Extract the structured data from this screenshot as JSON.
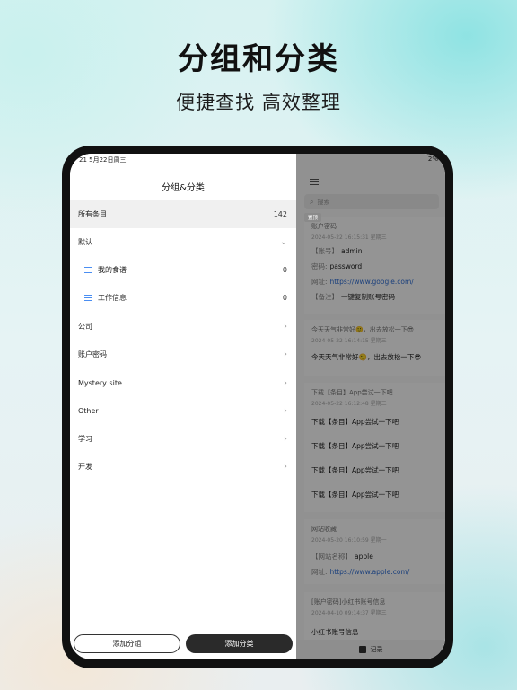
{
  "headline": "分组和分类",
  "subline": "便捷查找 高效整理",
  "status_bar": {
    "time_date": "21   5月22日周三",
    "battery": "2%"
  },
  "sidebar": {
    "title": "分组&分类",
    "all_items": {
      "label": "所有条目",
      "count": "142"
    },
    "groups": [
      {
        "label": "默认",
        "chevron": "⌄"
      },
      {
        "label": "我的食谱",
        "count": "0",
        "icon": "list-icon"
      },
      {
        "label": "工作信息",
        "count": "0",
        "icon": "list-icon"
      },
      {
        "label": "公司",
        "chevron": "›"
      },
      {
        "label": "账户密码",
        "chevron": "›"
      },
      {
        "label": "Mystery site",
        "chevron": "›"
      },
      {
        "label": "Other",
        "chevron": "›"
      },
      {
        "label": "学习",
        "chevron": "›"
      },
      {
        "label": "开发",
        "chevron": "›"
      }
    ],
    "add_group_button": "添加分组",
    "add_category_button": "添加分类"
  },
  "main": {
    "search_placeholder": "搜索",
    "pin_tag": "置顶",
    "cards": [
      {
        "title": "账户密码",
        "date": "2024-05-22 16:15:31 星期三",
        "lines": [
          {
            "key": "【账号】",
            "value": "admin"
          },
          {
            "key": "密码:",
            "value": "password"
          },
          {
            "key": "网址:",
            "value": "https://www.google.com/",
            "link": true
          },
          {
            "key": "【备注】",
            "value": "一键复制账号密码"
          }
        ]
      },
      {
        "title": "今天天气非常好🙂，出去放松一下😎",
        "date": "2024-05-22 16:14:15 星期三",
        "lines": [
          {
            "key": "",
            "value": "今天天气非常好🙂，出去放松一下😎"
          }
        ]
      },
      {
        "title": "下载【条目】App尝试一下吧",
        "date": "2024-05-22 16:12:48 星期三",
        "lines": [
          {
            "key": "",
            "value": "下载【条目】App尝试一下吧"
          },
          {
            "key": "",
            "value": "下载【条目】App尝试一下吧"
          },
          {
            "key": "",
            "value": "下载【条目】App尝试一下吧"
          },
          {
            "key": "",
            "value": "下载【条目】App尝试一下吧"
          }
        ]
      },
      {
        "title": "网站收藏",
        "date": "2024-05-20 16:10:59 星期一",
        "lines": [
          {
            "key": "【网站名称】",
            "value": "apple"
          },
          {
            "key": "网址:",
            "value": "https://www.apple.com/",
            "link": true
          }
        ]
      },
      {
        "title": "[账户密码]小红书账号信息",
        "date": "2024-04-10 09:14:37 星期三",
        "lines": [
          {
            "key": "",
            "value": "小红书账号信息"
          }
        ]
      }
    ],
    "bottom_tab_label": "记录"
  }
}
